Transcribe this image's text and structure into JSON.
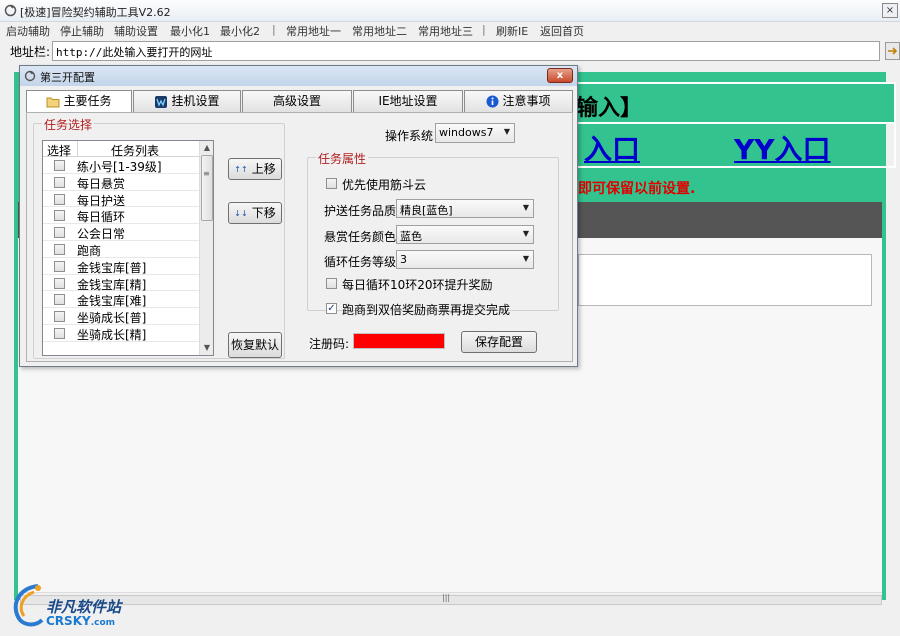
{
  "window": {
    "title": "[极速]冒险契约辅助工具V2.62",
    "close_label": "×"
  },
  "menu": {
    "items": [
      "启动辅助",
      "停止辅助",
      "辅助设置",
      "最小化1",
      "最小化2",
      "常用地址一",
      "常用地址二",
      "常用地址三",
      "刷新IE",
      "返回首页"
    ],
    "separator": "|"
  },
  "address": {
    "label": "地址栏:",
    "value": "http://此处输入要打开的网址"
  },
  "web": {
    "title": "输入】",
    "link1": "入口",
    "link2": "YY入口",
    "notice": "即可保留以前设置.",
    "bg_color": "#33c38f",
    "link_color": "#0000cc",
    "notice_color": "#e00000"
  },
  "watermark": {
    "line1": "非凡软件站",
    "line2": "CRSKY",
    "line2_suffix": ".com"
  },
  "dialog": {
    "title": "第三开配置",
    "close_label": "x",
    "tabs": [
      {
        "label": "主要任务",
        "icon": "folder-icon",
        "active": true
      },
      {
        "label": "挂机设置",
        "icon": "game-icon",
        "active": false
      },
      {
        "label": "高级设置",
        "icon": "",
        "active": false
      },
      {
        "label": "IE地址设置",
        "icon": "",
        "active": false
      },
      {
        "label": "注意事项",
        "icon": "info-icon",
        "active": false
      }
    ],
    "task_group": {
      "title": "任务选择",
      "col_select": "选择",
      "col_list": "任务列表",
      "tasks": [
        "练小号[1-39级]",
        "每日悬赏",
        "每日护送",
        "每日循环",
        "公会日常",
        "跑商",
        "金钱宝库[普]",
        "金钱宝库[精]",
        "金钱宝库[难]",
        "坐骑成长[普]",
        "坐骑成长[精]"
      ],
      "btn_up": "上移",
      "btn_down": "下移",
      "btn_reset": "恢复默认"
    },
    "os": {
      "label": "操作系统",
      "value": "windows7"
    },
    "props": {
      "title": "任务属性",
      "use_cloud": {
        "label": "优先使用筋斗云",
        "checked": false
      },
      "escort_quality": {
        "label": "护送任务品质",
        "value": "精良[蓝色]"
      },
      "bounty_color": {
        "label": "悬赏任务颜色",
        "value": "蓝色"
      },
      "loop_level": {
        "label": "循环任务等级",
        "value": "3"
      },
      "loop_reward": {
        "label": "每日循环10环20环提升奖励",
        "checked": false
      },
      "double_reward": {
        "label": "跑商到双倍奖励商票再提交完成",
        "checked": true
      }
    },
    "reg": {
      "label": "注册码:",
      "box_color": "#ff0000"
    },
    "btn_save": "保存配置"
  }
}
